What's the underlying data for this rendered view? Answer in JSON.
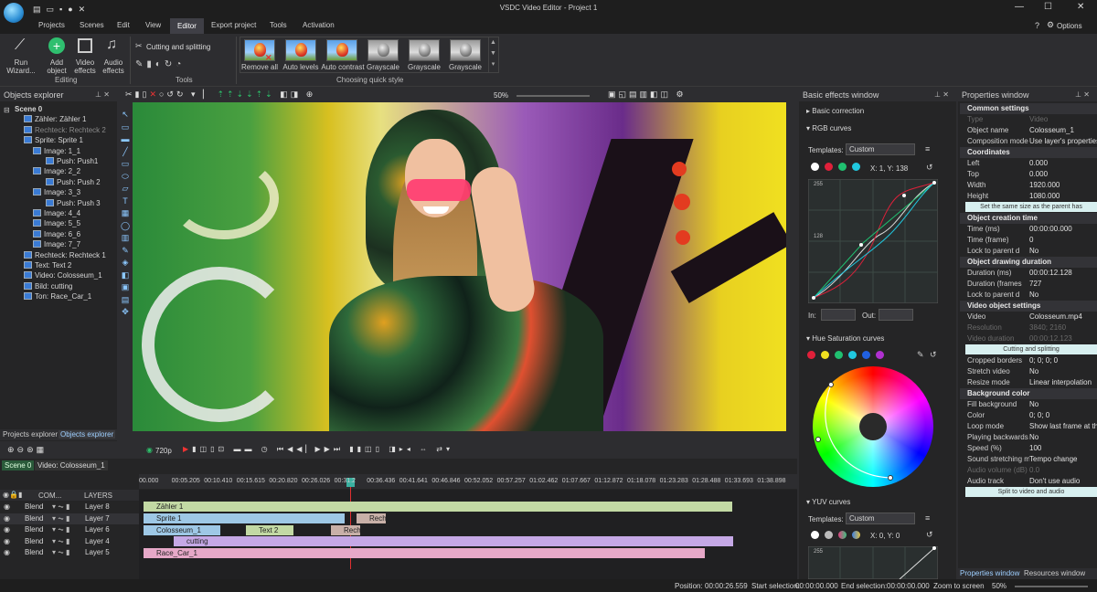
{
  "window": {
    "title": "VSDC Video Editor - Project 1",
    "options_label": "Options"
  },
  "menu": [
    "Projects",
    "Scenes",
    "Edit",
    "View",
    "Editor",
    "Export project",
    "Tools",
    "Activation"
  ],
  "menu_active": "Editor",
  "ribbon": {
    "run_wizard": "Run\nWizard...",
    "add_object": "Add\nobject",
    "video_effects": "Video\neffects",
    "audio_effects": "Audio\neffects",
    "editing_group": "Editing",
    "cutting": "Cutting and splitting",
    "tools_group": "Tools",
    "styles": [
      "Remove all",
      "Auto levels",
      "Auto contrast",
      "Grayscale",
      "Grayscale",
      "Grayscale"
    ],
    "styles_group": "Choosing quick style"
  },
  "objects_explorer": {
    "title": "Objects explorer",
    "items": [
      {
        "label": "Scene 0",
        "bold": true
      },
      {
        "label": "Zähler: Zähler 1"
      },
      {
        "label": "Rechteck: Rechteck 2",
        "dim": true
      },
      {
        "label": "Sprite: Sprite 1"
      },
      {
        "label": "Image: 1_1"
      },
      {
        "label": "Push: Push1"
      },
      {
        "label": "Image: 2_2"
      },
      {
        "label": "Push: Push 2"
      },
      {
        "label": "Image: 3_3"
      },
      {
        "label": "Push: Push 3"
      },
      {
        "label": "Image: 4_4"
      },
      {
        "label": "Image: 5_5"
      },
      {
        "label": "Image: 6_6"
      },
      {
        "label": "Image: 7_7"
      },
      {
        "label": "Rechteck: Rechteck 1"
      },
      {
        "label": "Text: Text 2"
      },
      {
        "label": "Video: Colosseum_1"
      },
      {
        "label": "Bild: cutting"
      },
      {
        "label": "Ton: Race_Car_1"
      }
    ],
    "tabs": [
      "Projects explorer",
      "Objects explorer"
    ]
  },
  "toolbar": {
    "zoom": "50%"
  },
  "playback": {
    "resolution": "720p"
  },
  "basic_effects": {
    "title": "Basic effects window",
    "basic_correction": "Basic correction",
    "rgb_curves": "RGB curves",
    "templates_label": "Templates:",
    "templates_value": "Custom",
    "coords": "X: 1, Y: 138",
    "axis_top": "255",
    "axis_mid": "128",
    "in_label": "In:",
    "out_label": "Out:",
    "hue_sat": "Hue Saturation curves",
    "yuv_curves": "YUV curves",
    "yuv_templates_value": "Custom",
    "yuv_coords": "X: 0, Y: 0",
    "yuv_axis_top": "255"
  },
  "properties": {
    "title": "Properties window",
    "sections": {
      "common": "Common settings",
      "coordinates": "Coordinates",
      "creation": "Object creation time",
      "drawing": "Object drawing duration",
      "video": "Video object settings",
      "bg": "Background color"
    },
    "rows_common": [
      {
        "k": "Type",
        "v": "Video",
        "dim": true
      },
      {
        "k": "Object name",
        "v": "Colosseum_1"
      },
      {
        "k": "Composition mode",
        "v": "Use layer's properties"
      }
    ],
    "rows_coords": [
      {
        "k": "Left",
        "v": "0.000"
      },
      {
        "k": "Top",
        "v": "0.000"
      },
      {
        "k": "Width",
        "v": "1920.000"
      },
      {
        "k": "Height",
        "v": "1080.000"
      }
    ],
    "same_size_btn": "Set the same size as the parent has",
    "rows_creation": [
      {
        "k": "Time (ms)",
        "v": "00:00:00.000"
      },
      {
        "k": "Time (frame)",
        "v": "0"
      },
      {
        "k": "Lock to parent d",
        "v": "No"
      }
    ],
    "rows_drawing": [
      {
        "k": "Duration (ms)",
        "v": "00:00:12.128"
      },
      {
        "k": "Duration (frames",
        "v": "727"
      },
      {
        "k": "Lock to parent d",
        "v": "No"
      }
    ],
    "rows_video": [
      {
        "k": "Video",
        "v": "Colosseum.mp4"
      },
      {
        "k": "Resolution",
        "v": "3840; 2160",
        "dim": true
      },
      {
        "k": "Video duration",
        "v": "00:00:12.123",
        "dim": true
      }
    ],
    "cutting_btn": "Cutting and splitting",
    "rows_video2": [
      {
        "k": "Cropped borders",
        "v": "0; 0; 0; 0"
      },
      {
        "k": "Stretch video",
        "v": "No"
      },
      {
        "k": "Resize mode",
        "v": "Linear interpolation"
      }
    ],
    "rows_bg": [
      {
        "k": "Fill background",
        "v": "No"
      },
      {
        "k": "Color",
        "v": "0; 0; 0"
      }
    ],
    "rows_tail": [
      {
        "k": "Loop mode",
        "v": "Show last frame at the"
      },
      {
        "k": "Playing backwards",
        "v": "No"
      },
      {
        "k": "Speed (%)",
        "v": "100"
      },
      {
        "k": "Sound stretching m",
        "v": "Tempo change"
      },
      {
        "k": "Audio volume (dB)",
        "v": "0.0",
        "dim": true
      },
      {
        "k": "Audio track",
        "v": "Don't use audio"
      }
    ],
    "split_btn": "Split to video and audio",
    "tabs": [
      "Properties window",
      "Resources window"
    ]
  },
  "timeline": {
    "tabs": [
      "Scene 0",
      "Video: Colosseum_1"
    ],
    "header_com": "COM...",
    "header_layers": "LAYERS",
    "ruler": [
      "00.000",
      "00:05.205",
      "00:10.410",
      "00:15.615",
      "00:20.820",
      "00:26.026",
      "00:31.2",
      "00:36.436",
      "00:41.641",
      "00:46.846",
      "00:52.052",
      "00:57.257",
      "01:02.462",
      "01:07.667",
      "01:12.872",
      "01:18.078",
      "01:23.283",
      "01:28.488",
      "01:33.693",
      "01:38.898"
    ],
    "layers": [
      {
        "blend": "Blend",
        "name": "Layer 8"
      },
      {
        "blend": "Blend",
        "name": "Layer 7"
      },
      {
        "blend": "Blend",
        "name": "Layer 6"
      },
      {
        "blend": "Blend",
        "name": "Layer 4"
      },
      {
        "blend": "Blend",
        "name": "Layer 5"
      }
    ],
    "clips": [
      "Zähler 1",
      "Sprite 1",
      "Rech",
      "Colosseum_1",
      "Text 2",
      "Rech",
      "cutting",
      "Race_Car_1"
    ]
  },
  "status": {
    "position_label": "Position:",
    "position": "00:00:26.559",
    "start_label": "Start selection:",
    "start": "00:00:00.000",
    "end_label": "End selection:",
    "end": "00:00:00.000",
    "zoom_label": "Zoom to screen",
    "zoom": "50%"
  },
  "colors": {
    "accent": "#2d8fd5",
    "track_green": "#c2d9a4",
    "track_blue": "#9ec8e6",
    "track_purple": "#c5a8e6",
    "track_pink": "#e6a8c8"
  }
}
